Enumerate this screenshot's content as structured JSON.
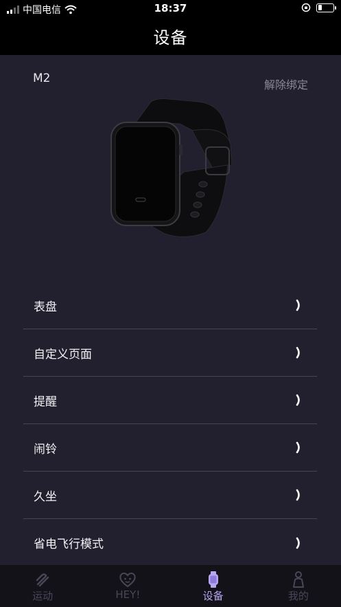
{
  "status_bar": {
    "carrier": "中国电信",
    "time": "18:37",
    "battery_level": 0.25
  },
  "header": {
    "title": "设备"
  },
  "device": {
    "model": "M2",
    "unbind_label": "解除绑定"
  },
  "menu": {
    "items": [
      {
        "label": "表盘"
      },
      {
        "label": "自定义页面"
      },
      {
        "label": "提醒"
      },
      {
        "label": "闹铃"
      },
      {
        "label": "久坐"
      },
      {
        "label": "省电飞行模式"
      }
    ]
  },
  "tabbar": {
    "tabs": [
      {
        "label": "运动",
        "icon": "sport-icon"
      },
      {
        "label": "HEY!",
        "icon": "hey-heart-icon"
      },
      {
        "label": "设备",
        "icon": "watch-icon"
      },
      {
        "label": "我的",
        "icon": "profile-icon"
      }
    ],
    "active_index": 2
  },
  "colors": {
    "background": "#221f2e",
    "header": "#000000",
    "divider": "#46435a",
    "tab_active": "#b7a6f2",
    "tab_inactive": "#4a4658"
  }
}
